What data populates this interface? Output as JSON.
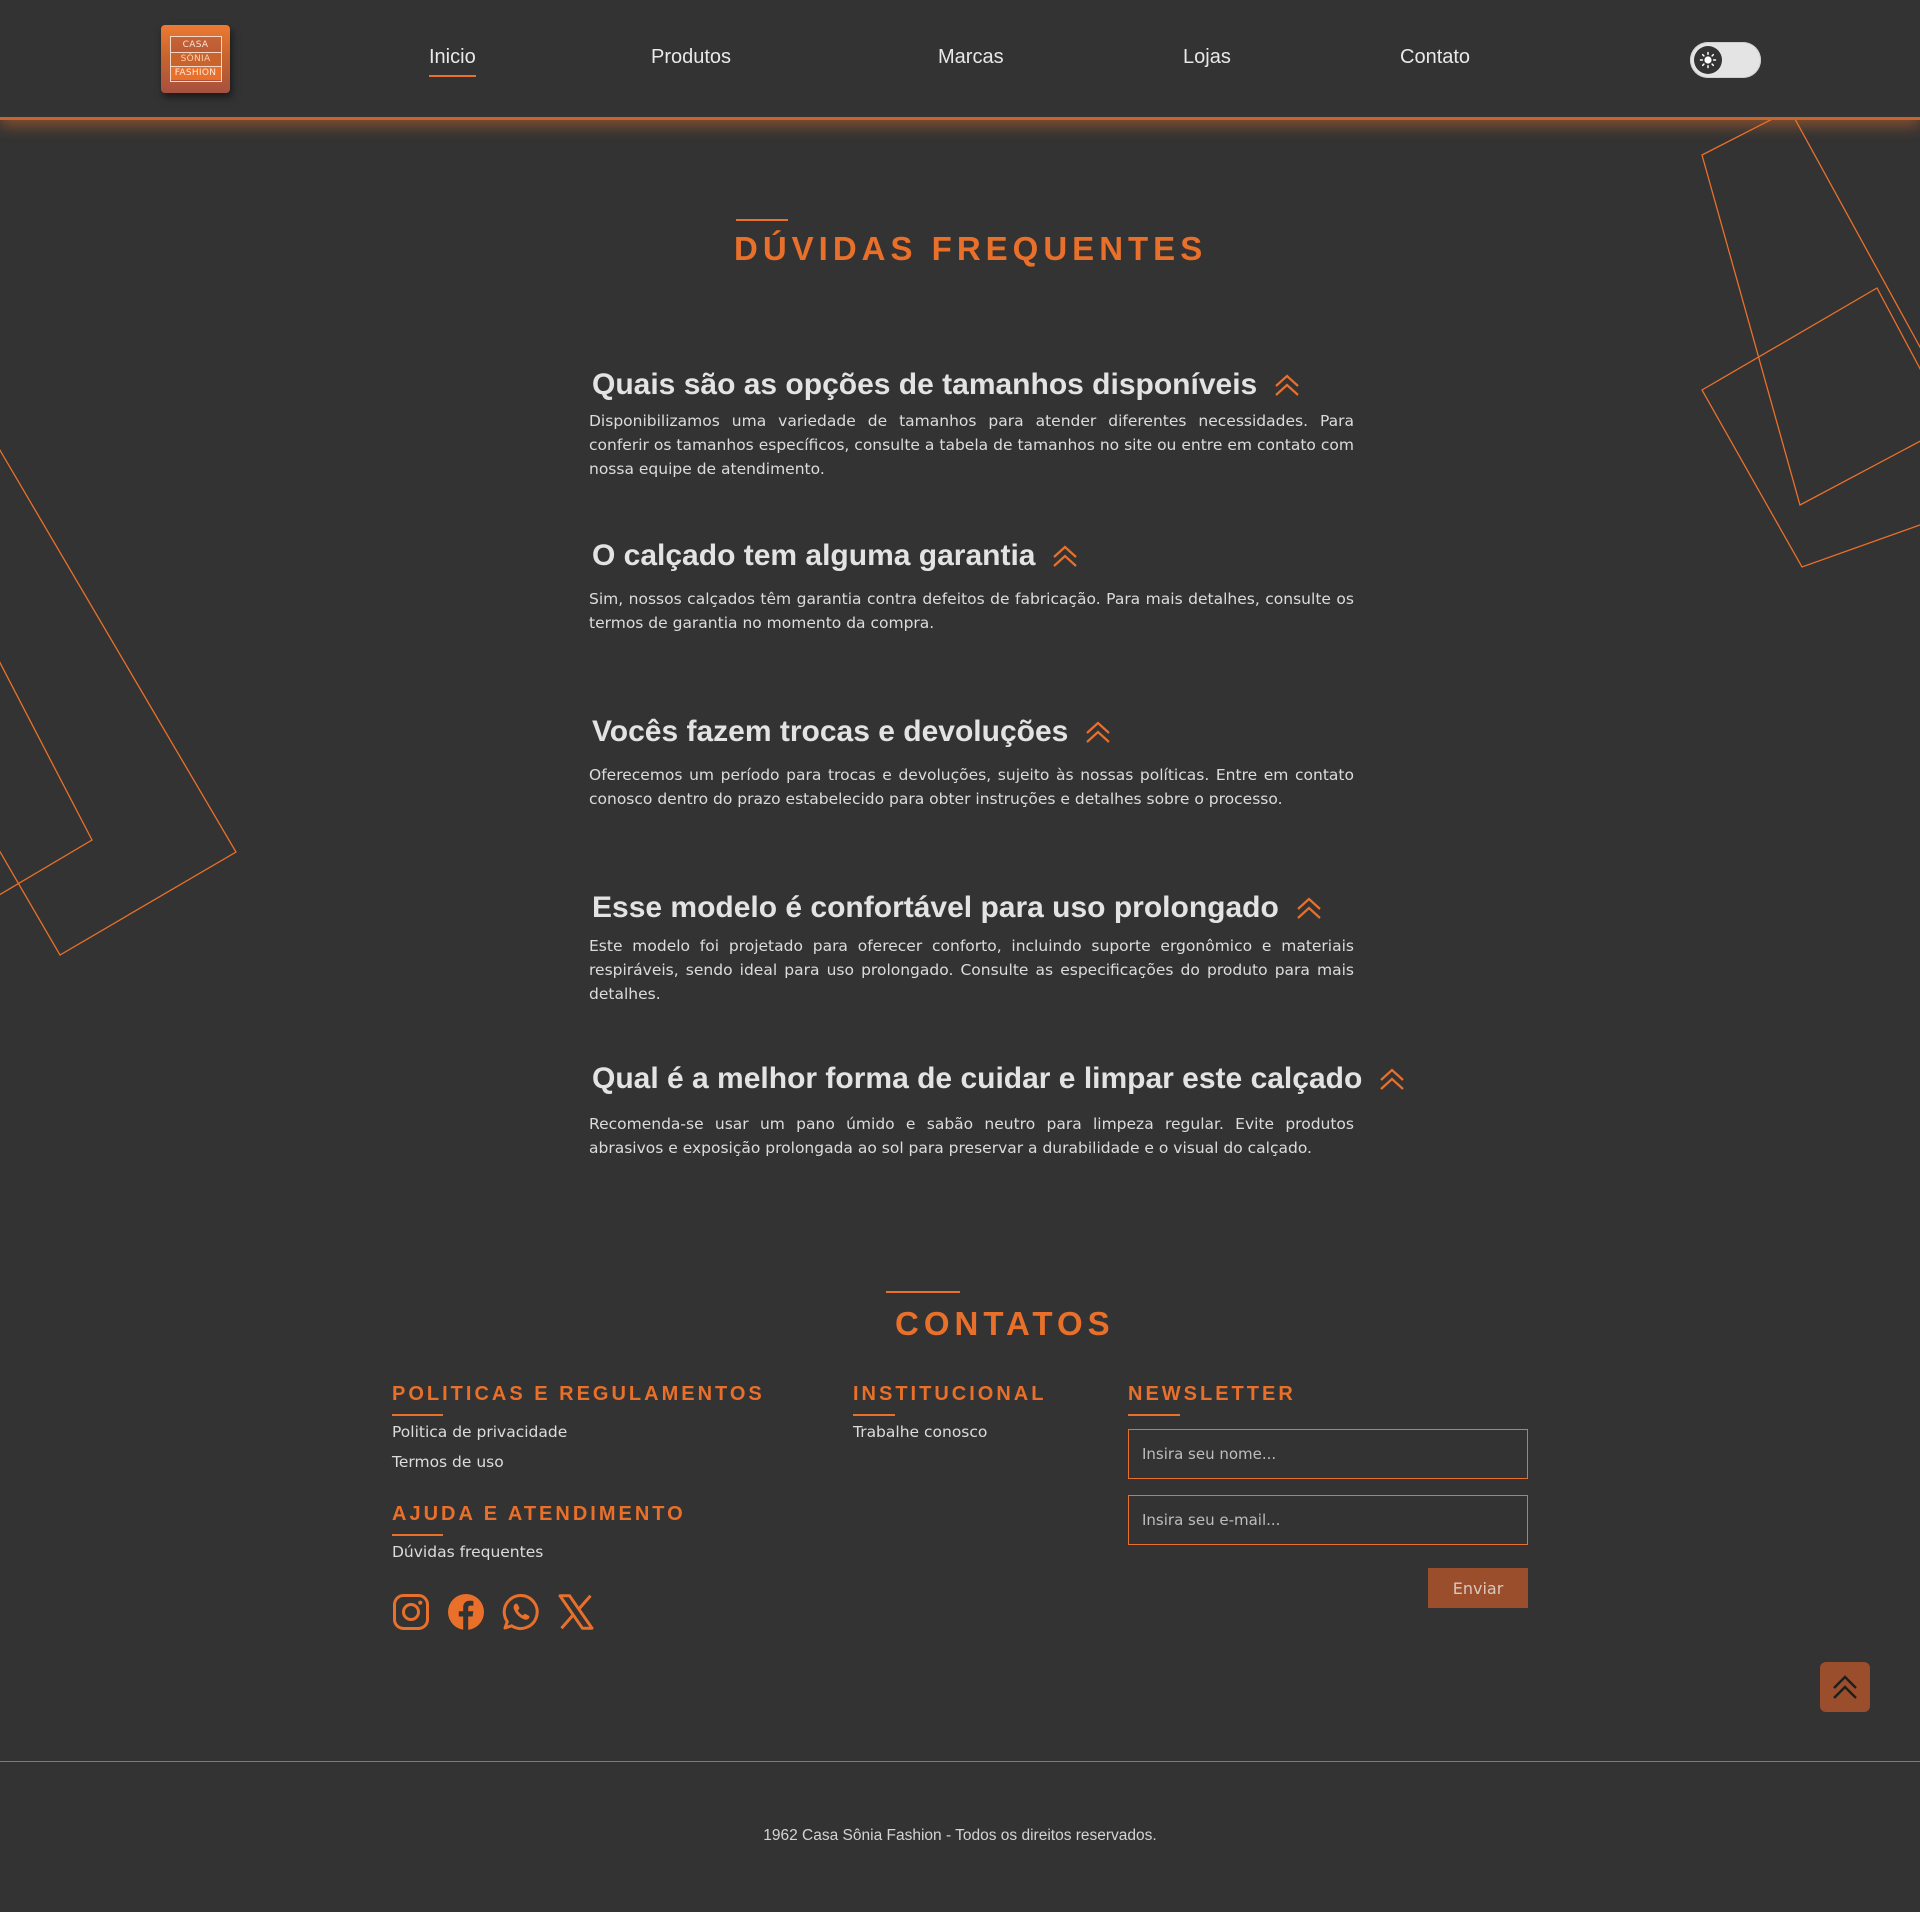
{
  "colors": {
    "background": "#333333",
    "accent": "#e9702a",
    "button": "#9a4e2c",
    "text": "#e6e6e6"
  },
  "header": {
    "logo": {
      "line1": "CASA",
      "line2": "SÔNIA",
      "line3": "FASHION"
    },
    "nav": [
      {
        "label": "Inicio",
        "active": true
      },
      {
        "label": "Produtos"
      },
      {
        "label": "Marcas"
      },
      {
        "label": "Lojas"
      },
      {
        "label": "Contato"
      }
    ],
    "theme_toggle_icon": "sun-icon"
  },
  "faq": {
    "title": "DÚVIDAS FREQUENTES",
    "items": [
      {
        "question": "Quais são as opções de tamanhos disponíveis",
        "answer": "Disponibilizamos uma variedade de tamanhos para atender diferentes necessidades. Para conferir os tamanhos específicos, consulte a tabela de tamanhos no site ou entre em contato com nossa equipe de atendimento."
      },
      {
        "question": "O calçado tem alguma garantia",
        "answer": "Sim, nossos calçados têm garantia contra defeitos de fabricação. Para mais detalhes, consulte os termos de garantia no momento da compra."
      },
      {
        "question": "Vocês fazem trocas e devoluções",
        "answer": "Oferecemos um período para trocas e devoluções, sujeito às nossas políticas. Entre em contato conosco dentro do prazo estabelecido para obter instruções e detalhes sobre o processo."
      },
      {
        "question": "Esse modelo é confortável para uso prolongado",
        "answer": "Este modelo foi projetado para oferecer conforto, incluindo suporte ergonômico e materiais respiráveis, sendo ideal para uso prolongado. Consulte as especificações do produto para mais detalhes."
      },
      {
        "question": "Qual é a melhor forma de cuidar e limpar este calçado",
        "answer": "Recomenda-se usar um pano úmido e sabão neutro para limpeza regular. Evite produtos abrasivos e exposição prolongada ao sol para preservar a durabilidade e o visual do calçado."
      }
    ]
  },
  "contacts": {
    "title": "CONTATOS",
    "policies": {
      "title": "POLITICAS E REGULAMENTOS",
      "links": [
        "Politica de privacidade",
        "Termos de uso"
      ]
    },
    "institutional": {
      "title": "INSTITUCIONAL",
      "links": [
        "Trabalhe conosco"
      ]
    },
    "help": {
      "title": "AJUDA E ATENDIMENTO",
      "links": [
        "Dúvidas frequentes"
      ]
    },
    "socials": [
      "instagram-icon",
      "facebook-icon",
      "whatsapp-icon",
      "x-icon"
    ],
    "newsletter": {
      "title": "NEWSLETTER",
      "name_placeholder": "Insira seu nome...",
      "email_placeholder": "Insira seu e-mail...",
      "button_label": "Enviar"
    }
  },
  "footer": {
    "copyright": "1962 Casa Sônia Fashion - Todos os direitos reservados."
  }
}
